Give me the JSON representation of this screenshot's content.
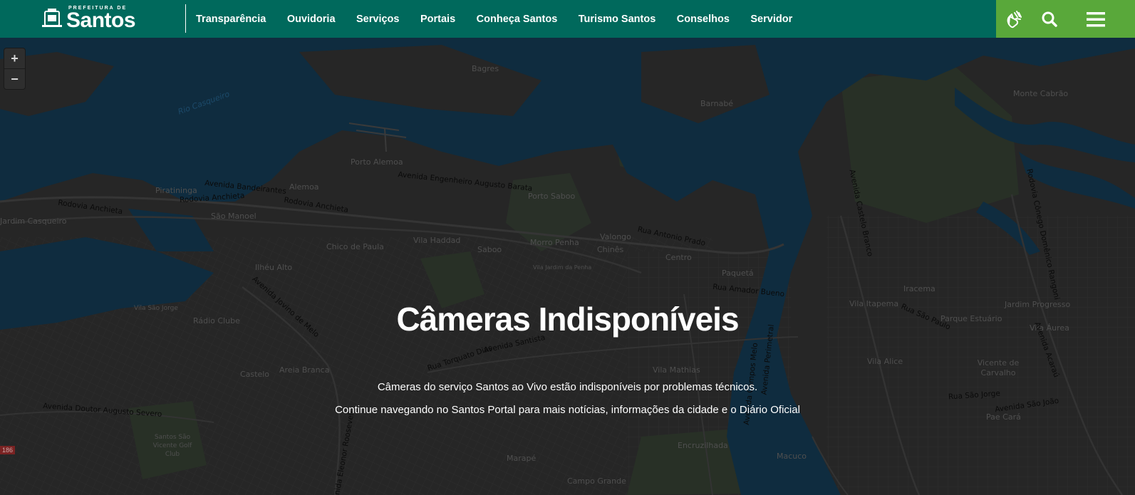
{
  "header": {
    "logo": {
      "small_text": "PREFEITURA DE",
      "big_text": "Santos"
    },
    "nav": [
      {
        "label": "Transparência"
      },
      {
        "label": "Ouvidoria"
      },
      {
        "label": "Serviços"
      },
      {
        "label": "Portais"
      },
      {
        "label": "Conheça Santos"
      },
      {
        "label": "Turismo Santos"
      },
      {
        "label": "Conselhos"
      },
      {
        "label": "Servidor"
      }
    ],
    "tools": {
      "sign_language": "sign-language-icon",
      "search": "search-icon",
      "menu": "hamburger-menu-icon"
    },
    "colors": {
      "primary": "#00695c",
      "accent": "#59a83a"
    }
  },
  "map": {
    "zoom_in": "+",
    "zoom_out": "−",
    "badge": "186",
    "labels": {
      "bagres": "Bagres",
      "barnabe": "Barnabé",
      "monte_cabrao": "Monte Cabrão",
      "rio_casqueiro": "Rio Casqueiro",
      "porto_alemoa": "Porto Alemoa",
      "av_eng_augusto_barata": "Avenida Engenheiro Augusto Barata",
      "porto_saboo": "Porto Saboo",
      "piratininga": "Piratininga",
      "av_bandeirantes": "Avenida Bandeirantes",
      "alemoa": "Alemoa",
      "rod_anchieta_1": "Rodovia Anchieta",
      "rod_anchieta_2": "Rodovia Anchieta",
      "rod_anchieta_3": "Rodovia Anchieta",
      "sao_manoel": "São Manoel",
      "jardim_casqueiro": "Jardim Casqueiro",
      "vila_haddad": "Vila Haddad",
      "saboo": "Saboo",
      "morro_penha": "Morro Penha",
      "valongo": "Valongo",
      "chines": "Chinês",
      "rua_antonio_prado": "Rua Antonio Prado",
      "centro": "Centro",
      "chico_de_paula": "Chico de Paula",
      "ilheu_alto": "Ilhéu Alto",
      "vila_jardim_penha": "Vila Jardim da Penha",
      "paqueta": "Paquetá",
      "rua_amador_bueno": "Rua Amador Bueno",
      "av_castelo_branco": "Avenida Castelo Branco",
      "rod_conego_domenico": "Rodovia Cônego Domênico Rangoni",
      "iracema": "Iracema",
      "vila_itapema": "Vila Itapema",
      "rua_sao_paulo": "Rua São Paulo",
      "parque_estuario": "Parque Estuário",
      "jardim_progresso": "Jardim Progresso",
      "vila_aurea": "Vila Áurea",
      "radio_clube": "Rádio Clube",
      "av_jovino_de_melo": "Avenida Jovino de Melo",
      "vila_sao_jorge": "Vila São Jorge",
      "av_santista": "Avenida Santista",
      "rua_torquato_dias": "Rua Torquato Dias",
      "castelo": "Castelo",
      "areia_branca": "Areia Branca",
      "vila_mathias": "Vila Mathias",
      "vila_alice": "Vila Alice",
      "vicente_de_carvalho": "Vicente de Carvalho",
      "rua_sao_jorge": "Rua São Jorge",
      "av_sao_joao": "Avenida São João",
      "pae_cara": "Pae Cará",
      "av_acarau": "Avenida Acaraú",
      "av_doutor_augusto_severo": "Avenida Doutor Augusto Severo",
      "santos_golf": "Santos São Vicente Golf Club",
      "encruzilhada": "Encruzilhada",
      "macuco": "Macuco",
      "marape": "Marapé",
      "campo_grande": "Campo Grande",
      "av_eleonor_roosevelt": "Avenida Eleonor Roosevelt",
      "av_campos_melo": "Avenida Campos Melo",
      "av_perimetral": "Avenida Perimetral"
    }
  },
  "message": {
    "title": "Câmeras Indisponíveis",
    "line1": "Câmeras do serviço Santos ao Vivo estão indisponíveis por problemas técnicos.",
    "line2": "Continue navegando no Santos Portal para mais notícias, informações da cidade e o Diário Oficial"
  }
}
